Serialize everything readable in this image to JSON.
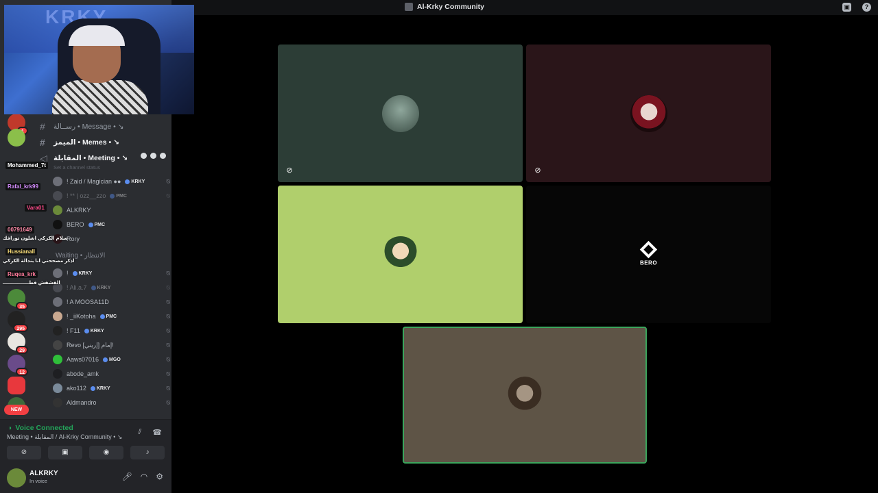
{
  "window": {
    "title": "Al-Krky Community"
  },
  "webcam": {
    "overlay_text": "KRKY"
  },
  "channels": [
    {
      "label": "ﺭﺳــﺎﻟﺔ • Message • ↘",
      "style": "dim"
    },
    {
      "label": "ﺍﻟﻤﻴﻤﺰ • Memes • ↘",
      "style": "bright"
    },
    {
      "label": "ﺍﻟﻤﻘﺎﺑﻠﺔ • Meeting • ↘",
      "style": "bright"
    }
  ],
  "channel_topic": "Set a channel status",
  "members_top": [
    {
      "name": "! Zaid / Magician ●●",
      "tag": "KRKY"
    },
    {
      "name": "! ** | ozz__zzo",
      "tag": "PMC"
    },
    {
      "name": "ALKRKY",
      "tag": ""
    },
    {
      "name": "BERO",
      "tag": "PMC"
    },
    {
      "name": "Rory",
      "tag": ""
    }
  ],
  "waiting_channel": "Waiting • ﺍﻻﻧﺘﻈﺎﺭ",
  "members_waiting": [
    {
      "name": "!",
      "tag": "KRKY"
    },
    {
      "name": "! Ali.a.7",
      "tag": "KRKY"
    },
    {
      "name": "! A MOOSA11D",
      "tag": ""
    },
    {
      "name": "! _iiKotoha",
      "tag": "PMC"
    },
    {
      "name": "! F11",
      "tag": "KRKY"
    },
    {
      "name": "Revo ﺇﻣﺎﻡ [ﺇﺭﻳﻨﻲ]!",
      "tag": ""
    },
    {
      "name": "Aaws07016",
      "tag": "MGO"
    },
    {
      "name": "abode_amk",
      "tag": ""
    },
    {
      "name": "ako112",
      "tag": "KRKY"
    },
    {
      "name": "Aldmandro",
      "tag": ""
    }
  ],
  "chat": [
    {
      "user": "Mohammed_7t",
      "color": "#ffffff",
      "text": ""
    },
    {
      "user": "Rafal_krk99",
      "color": "#d58cff",
      "text": ""
    },
    {
      "user": "Vara01",
      "color": "#ff4a8a",
      "text": ""
    },
    {
      "user": "00791649",
      "color": "#ff8aa8",
      "text": "ﺳﻼﻡ ﺍﻟﻜﺮﻛﻲ ﺍﺷﻠﻮﻥ ﺗﻮﺭﺍﻓﻚ"
    },
    {
      "user": "Hussianall",
      "color": "#ffe27a",
      "text": "ﺍﺫﻛﺮ ﻣﺼﺤﺤﻨﻲ ﺍﻧﺎ ﺑﻨﺪﺍﻟﺔ ﺍﻟﻜﺮﻛﻲ"
    },
    {
      "user": "Ruqea_krk",
      "color": "#ff7a9a",
      "text": "ﺍﻟﻔﺸﻔﺶ ﻗﻄــــــــــــــــ"
    }
  ],
  "server_badges": [
    "1",
    "35",
    "295",
    "29",
    "12"
  ],
  "server_new_label": "NEW",
  "voice": {
    "status": "Voice Connected",
    "location": "Meeting • ﺍﻟﻤﻘﺎﺑﻠﺔ / Al-Krky Community • ↘"
  },
  "user": {
    "name": "ALKRKY",
    "status": "In voice"
  },
  "stage": {
    "bero_label": "BERO"
  },
  "colors": {
    "accent_green": "#3ba55c",
    "danger": "#f23f42",
    "tile_lime": "#b0cf6c"
  }
}
